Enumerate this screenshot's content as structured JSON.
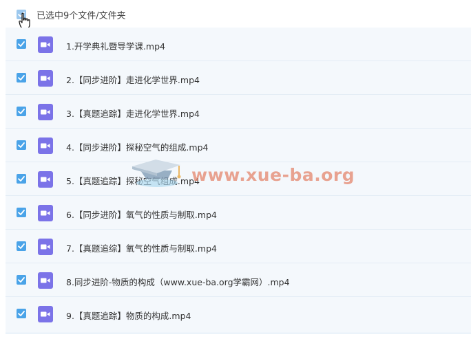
{
  "header": {
    "label": "已选中9个文件/文件夹"
  },
  "files": [
    {
      "name": "1.开学典礼暨导学课.mp4"
    },
    {
      "name": "2.【同步进阶】走进化学世界.mp4"
    },
    {
      "name": "3.【真题追踪】走进化学世界.mp4"
    },
    {
      "name": "4.【同步进阶】探秘空气的组成.mp4"
    },
    {
      "name": "5.【真题追踪】探秘空气组成.mp4"
    },
    {
      "name": "6.【同步进阶】氧气的性质与制取.mp4"
    },
    {
      "name": "7.【真题追综】氧气的性质与制取.mp4"
    },
    {
      "name": "8.同步进阶-物质的构成（www.xue-ba.org学霸网）.mp4"
    },
    {
      "name": "9.【真题追踪】物质的构成.mp4"
    }
  ],
  "watermark": {
    "text": "www.xue-ba.org"
  },
  "colors": {
    "checkbox": "#4aa3e8",
    "video_icon": "#7b73e8",
    "list_bg": "#f4f8fc"
  },
  "icons": {
    "checkbox": "check-icon",
    "file": "video-file-icon",
    "cursor": "hand-cursor-icon"
  }
}
